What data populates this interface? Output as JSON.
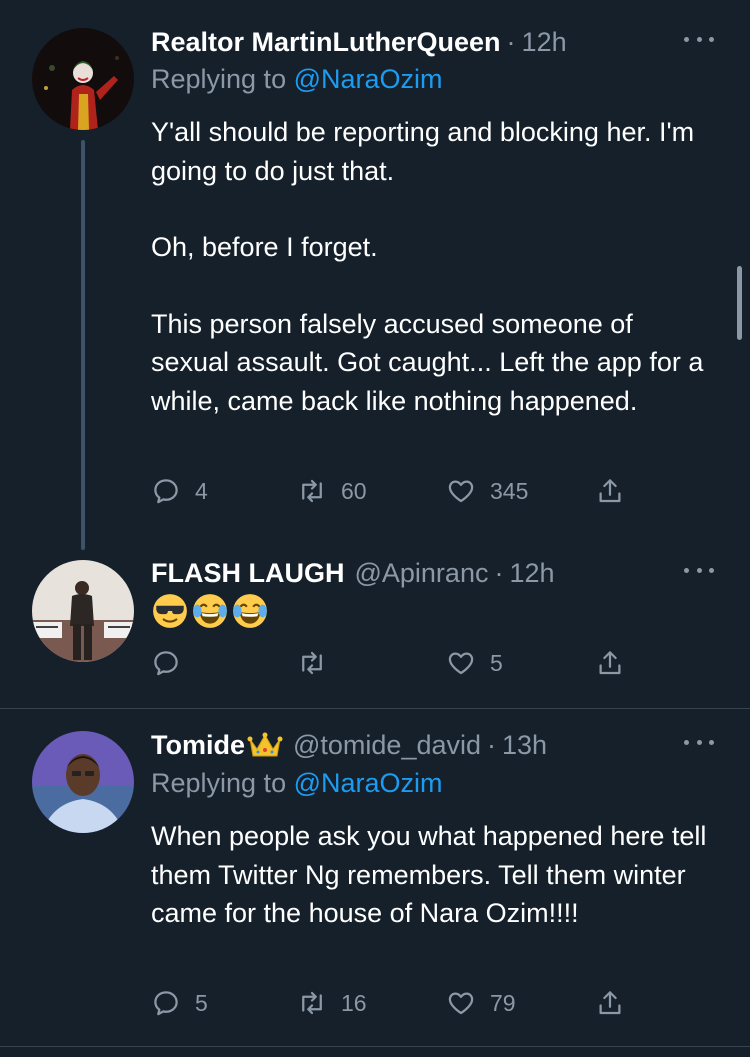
{
  "tweets": [
    {
      "name": "Realtor MartinLutherQueen",
      "handle": "",
      "time": "12h",
      "replying_label": "Replying to",
      "replying_to": "@NaraOzim",
      "paragraphs": [
        "Y'all should be reporting and blocking her. I'm going to do just that.",
        "Oh, before I forget.",
        "This person falsely accused someone of sexual assault. Got caught... Left the app for a while, came back like nothing happened."
      ],
      "replies": "4",
      "retweets": "60",
      "likes": "345"
    },
    {
      "name": "FLASH LAUGH",
      "handle": "@Apinranc",
      "time": "12h",
      "emojis": [
        "sunglasses-emoji",
        "joy-emoji",
        "joy-emoji"
      ],
      "replies": "",
      "retweets": "",
      "likes": "5"
    },
    {
      "name": "Tomide",
      "name_badge": "crown-emoji",
      "handle": "@tomide_david",
      "time": "13h",
      "replying_label": "Replying to",
      "replying_to": "@NaraOzim",
      "paragraphs": [
        "When people ask you what happened here tell them Twitter Ng remembers. Tell them winter came for the house of Nara Ozim!!!!"
      ],
      "replies": "5",
      "retweets": "16",
      "likes": "79"
    }
  ],
  "colors": {
    "background": "#15202b",
    "text": "#ffffff",
    "secondary": "#8b98a5",
    "link": "#1d9bf0",
    "divider": "#38444d"
  },
  "dot_separator": "·"
}
